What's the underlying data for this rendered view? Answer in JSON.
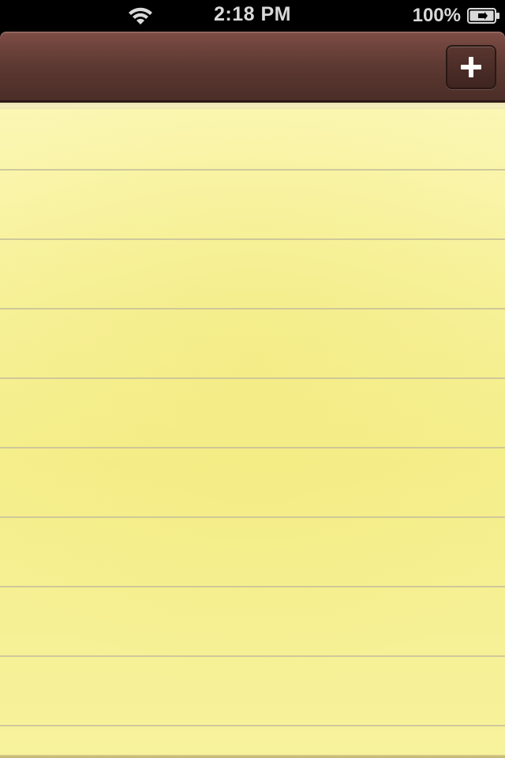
{
  "status_bar": {
    "time": "2:18 PM",
    "battery_percent": "100%",
    "wifi_icon": "wifi-icon",
    "battery_icon": "battery-charging-icon"
  },
  "nav_bar": {
    "add_button_icon": "plus-icon"
  },
  "paper": {
    "line_count": 9,
    "colors": {
      "paper": "#f7f19a",
      "rule": "#c8c19a",
      "nav_bar": "#5e3a33"
    }
  }
}
